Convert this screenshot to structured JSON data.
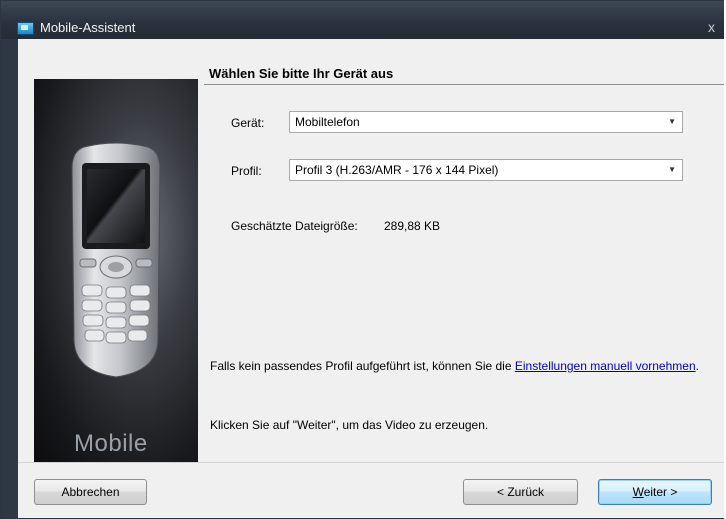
{
  "window": {
    "title": "Mobile-Assistent",
    "close_glyph": "x"
  },
  "main": {
    "heading": "Wählen Sie bitte Ihr Gerät aus",
    "promo_text": "Mobile",
    "device": {
      "label": "Gerät:",
      "value": "Mobiltelefon"
    },
    "profile": {
      "label": "Profil:",
      "value": "Profil 3 (H.263/AMR - 176 x 144 Pixel)"
    },
    "filesize": {
      "label": "Geschätzte Dateigröße:",
      "value": "289,88 KB"
    },
    "hint": {
      "prefix": "Falls kein passendes Profil aufgeführt ist, können Sie die ",
      "link": "Einstellungen manuell vornehmen",
      "suffix": "."
    },
    "instruction": "Klicken Sie auf \"Weiter\", um das Video zu erzeugen."
  },
  "footer": {
    "cancel_label": "Abbrechen",
    "back_label": "< Zurück",
    "next_label_ul": "W",
    "next_label_rest": "eiter >"
  },
  "icons": {
    "app": "video-mobile-icon",
    "close": "close-icon",
    "dropdown": "chevron-down-icon"
  }
}
